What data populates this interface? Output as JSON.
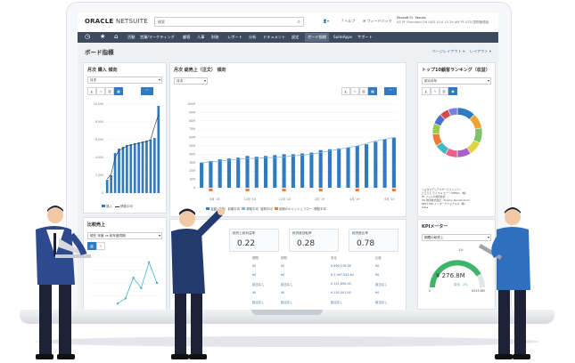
{
  "app": {
    "logo_oracle": "ORACLE",
    "logo_netsuite": "NETSUITE",
    "search_placeholder": "検索",
    "topbar_links": [
      "ヘルプ",
      "フィードバック"
    ],
    "user_name": "Mrosoft F.I. Yasuko",
    "user_detail": "AS PF Standard OH USD 10.0 15.29 AM PF-STD 国際管理者"
  },
  "nav": {
    "items": [
      "活動",
      "営業/マーケティング",
      "顧客",
      "人事",
      "財務",
      "レポート",
      "分析",
      "ドキュメント",
      "設定",
      "ボード指標",
      "SuiteApps",
      "サポート"
    ],
    "active_index": 9
  },
  "page": {
    "title": "ボード指標",
    "links": [
      "ページレイアウト ▾",
      "レイアウト ▾"
    ]
  },
  "portlets": {
    "monthly_purchase": {
      "title": "月次 購入 傾向",
      "select": "月次",
      "legend": [
        "購入",
        "移動平均"
      ]
    },
    "monthly_sales": {
      "title": "月次 総売上（注文） 傾向",
      "select": "月次",
      "legend": [
        "金額",
        "(正味)",
        "前期平均",
        "移動平均",
        "前期平均",
        "前期のキャッシュフロー",
        "移動平均"
      ]
    },
    "top_customers": {
      "title": "トップ10顧客ランキング（収益）",
      "select": "前の半年",
      "legend": [
        "トヨタマテリアルサービスジャパン",
        "とらえる ライフ & ビーー(DMSC)（株）",
        "PT ジャムカ株式会社",
        "ITS 物流株式会社（Tommy Japanbranch）",
        "BEST PKC インターナショナルズ（株）"
      ],
      "footer": "1/2 ▸"
    },
    "comparison": {
      "title": "比較売上",
      "select": "現在 年度 vs 前年度同期"
    },
    "kpi_summary": {
      "labels": [
        "総売上総利益率",
        "総資産回転率",
        "総資産比率"
      ],
      "values": [
        "0.22",
        "0.28",
        "0.78"
      ],
      "table_headers": [
        "期間",
        "前期",
        "変化",
        "比較"
      ],
      "rows": [
        [
          "¥0",
          "¥0",
          "¥ 696,276.58",
          "¥0"
        ],
        [
          "¥0",
          "¥0",
          "¥ 2,397,542.62",
          "¥0"
        ],
        [
          "該当なし",
          "該当なし",
          "¥ 131,890.00",
          "該当なし"
        ],
        [
          "¥0",
          "¥0",
          "¥ 130,001.00",
          "¥0"
        ],
        [
          "該当なし",
          "該当なし",
          "該当なし",
          "該当なし"
        ]
      ]
    },
    "kpi_meter": {
      "title": "KPIメーター",
      "select": "期間の総売上",
      "value": "¥ 276.8M",
      "scale_min": "0",
      "scale_top": "-1%",
      "scale_right": "¥325.8M",
      "change_label": "変化：2%"
    }
  },
  "chart_data": [
    {
      "type": "bar",
      "title": "月次 購入 傾向",
      "ylabel": "",
      "yticks": [
        "10,000",
        "8,000",
        "6,000",
        "4,000",
        "2,000",
        "0"
      ],
      "series": [
        {
          "name": "購入",
          "values": [
            1.5,
            2,
            4.5,
            5,
            5.2,
            5.4,
            5.5,
            5.6,
            5.7,
            5.8,
            5.9,
            6.0,
            6.2,
            9.8
          ]
        },
        {
          "name": "移動平均",
          "values": [
            1.6,
            2.1,
            4.0,
            4.8,
            5.0,
            5.3,
            5.4,
            5.5,
            5.6,
            5.7,
            5.8,
            6.0,
            7.5,
            8.8
          ]
        }
      ]
    },
    {
      "type": "bar",
      "title": "月次 総売上（注文） 傾向",
      "yticks": [
        "100M",
        "90M",
        "80M",
        "70M",
        "60M",
        "50M",
        "40M",
        "30M",
        "20M",
        "10M",
        "0"
      ],
      "categories": [
        "8月 '18",
        "10月 '18",
        "12月 '18",
        "2月 '19",
        "4月 '19",
        "6月 '19"
      ],
      "series": [
        {
          "name": "金額",
          "values": [
            30,
            32,
            34,
            35,
            36,
            38,
            37,
            38,
            39,
            40,
            40,
            41,
            42,
            45,
            46,
            47,
            48,
            50,
            52,
            55,
            58,
            60
          ]
        },
        {
          "name": "移動平均",
          "values": [
            30,
            31,
            32,
            33,
            34,
            35,
            35,
            36,
            36,
            37,
            38,
            39,
            40,
            42,
            44,
            46,
            48,
            50,
            53,
            56,
            58,
            60
          ]
        }
      ]
    },
    {
      "type": "pie",
      "title": "トップ10顧客ランキング（収益）",
      "values": [
        12,
        10,
        10,
        9,
        9,
        8,
        8,
        8,
        7,
        7,
        6,
        6
      ],
      "colors": [
        "#2f7ac0",
        "#f0a22e",
        "#7cc36a",
        "#e0d23b",
        "#a95fc6",
        "#e8608b",
        "#45b8c8",
        "#f07b35",
        "#9acb4f",
        "#4a6fd1",
        "#d64b4b",
        "#7a7fd8"
      ]
    },
    {
      "type": "line",
      "title": "比較売上",
      "series": [
        {
          "name": "現在 年度",
          "values": [
            0.1,
            0.2,
            0.6,
            0.4,
            0.9,
            0.5
          ]
        }
      ]
    }
  ]
}
